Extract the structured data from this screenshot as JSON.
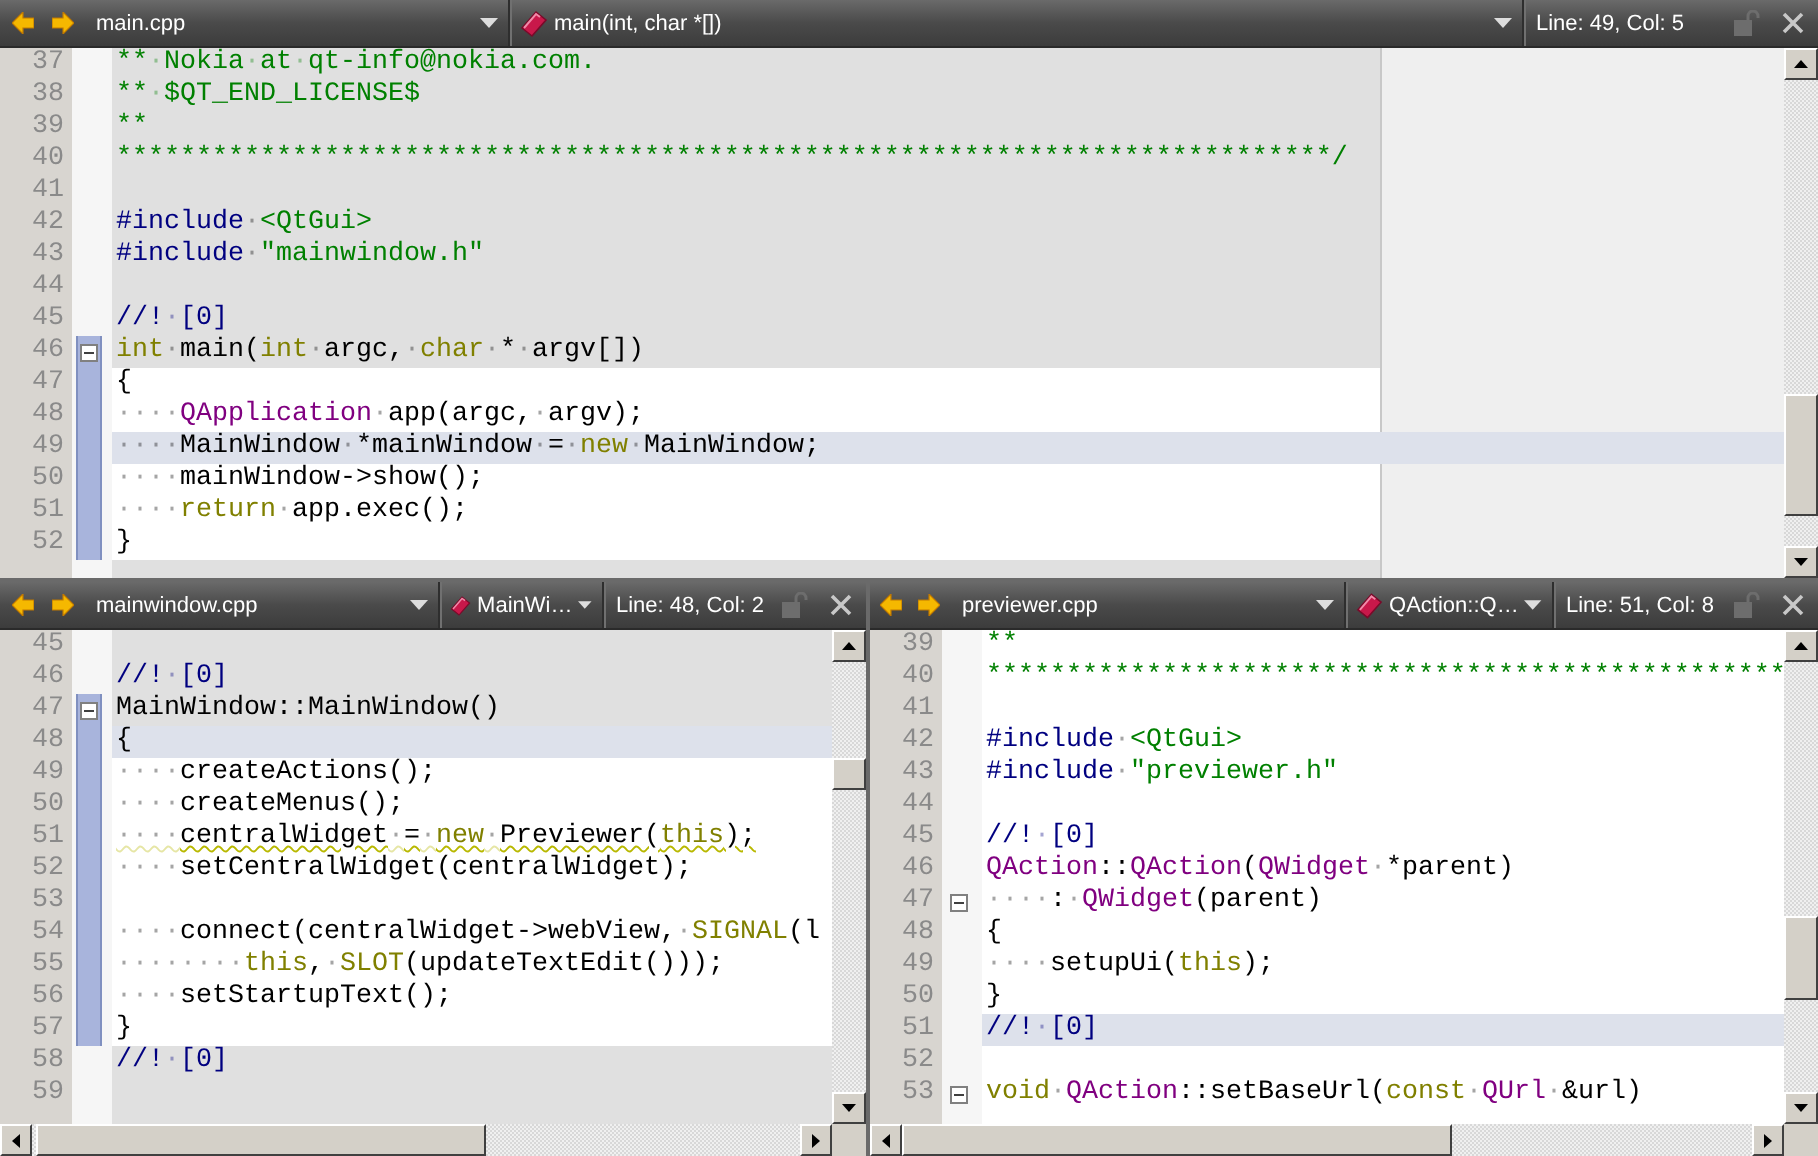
{
  "panes": [
    {
      "toolbar": {
        "file": "main.cpp",
        "symbol": "main(int, char *[])",
        "position": "Line: 49, Col: 5"
      },
      "dimmed": true,
      "lines": [
        {
          "number": "37",
          "tokens": [
            {
              "kind": "comment",
              "text": "**·Nokia·at·qt-info@nokia.com."
            }
          ]
        },
        {
          "number": "38",
          "tokens": [
            {
              "kind": "comment",
              "text": "**·$QT_END_LICENSE$"
            }
          ]
        },
        {
          "number": "39",
          "tokens": [
            {
              "kind": "comment",
              "text": "**"
            }
          ]
        },
        {
          "number": "40",
          "tokens": [
            {
              "kind": "comment",
              "text": "****************************************************************************/"
            }
          ]
        },
        {
          "number": "41"
        },
        {
          "number": "42",
          "tokens": [
            {
              "kind": "preproc",
              "text": "#include"
            },
            {
              "kind": "plain",
              "text": "·"
            },
            {
              "kind": "string",
              "text": "<QtGui>"
            }
          ]
        },
        {
          "number": "43",
          "tokens": [
            {
              "kind": "preproc",
              "text": "#include"
            },
            {
              "kind": "plain",
              "text": "·"
            },
            {
              "kind": "string",
              "text": "\"mainwindow.h\""
            }
          ]
        },
        {
          "number": "44"
        },
        {
          "number": "45",
          "tokens": [
            {
              "kind": "doc",
              "text": "//!·[0]"
            }
          ]
        },
        {
          "number": "46",
          "fold": true,
          "scope": true,
          "in_block": false,
          "current": false,
          "tokens": [
            {
              "kind": "keyword",
              "text": "int"
            },
            {
              "kind": "plain",
              "text": "·main("
            },
            {
              "kind": "keyword",
              "text": "int"
            },
            {
              "kind": "plain",
              "text": "·argc,·"
            },
            {
              "kind": "keyword",
              "text": "char"
            },
            {
              "kind": "plain",
              "text": "·*·argv[])"
            }
          ]
        },
        {
          "number": "47",
          "scope": true,
          "in_block": true,
          "current": false,
          "tokens": [
            {
              "kind": "plain",
              "text": "{"
            }
          ]
        },
        {
          "number": "48",
          "scope": true,
          "in_block": true,
          "current": false,
          "tokens": [
            {
              "kind": "plain",
              "text": "····"
            },
            {
              "kind": "type",
              "text": "QApplication"
            },
            {
              "kind": "plain",
              "text": "·app(argc,·argv);"
            }
          ]
        },
        {
          "number": "49",
          "scope": true,
          "current": true,
          "tokens": [
            {
              "kind": "plain",
              "text": "····MainWindow·*mainWindow·=·"
            },
            {
              "kind": "keyword",
              "text": "new"
            },
            {
              "kind": "plain",
              "text": "·MainWindow;"
            }
          ]
        },
        {
          "number": "50",
          "scope": true,
          "in_block": true,
          "current": false,
          "tokens": [
            {
              "kind": "plain",
              "text": "····mainWindow->show();"
            }
          ]
        },
        {
          "number": "51",
          "scope": true,
          "in_block": true,
          "current": false,
          "tokens": [
            {
              "kind": "plain",
              "text": "····"
            },
            {
              "kind": "keyword",
              "text": "return"
            },
            {
              "kind": "plain",
              "text": "·app.exec();"
            }
          ]
        },
        {
          "number": "52",
          "scope": true,
          "in_block": true,
          "current": false,
          "tokens": [
            {
              "kind": "plain",
              "text": "}"
            }
          ]
        }
      ]
    },
    {
      "toolbar": {
        "file": "mainwindow.cpp",
        "symbol": "MainWi…",
        "position": "Line: 48, Col: 2"
      },
      "dimmed": true,
      "lines": [
        {
          "number": "45"
        },
        {
          "number": "46",
          "tokens": [
            {
              "kind": "doc",
              "text": "//!·[0]"
            }
          ]
        },
        {
          "number": "47",
          "fold": true,
          "scope": true,
          "in_block": false,
          "current": false,
          "tokens": [
            {
              "kind": "plain",
              "text": "MainWindow::MainWindow()"
            }
          ]
        },
        {
          "number": "48",
          "scope": true,
          "current": true,
          "tokens": [
            {
              "kind": "plain",
              "text": "{"
            }
          ]
        },
        {
          "number": "49",
          "scope": true,
          "in_block": true,
          "current": false,
          "tokens": [
            {
              "kind": "plain",
              "text": "····createActions();"
            }
          ]
        },
        {
          "number": "50",
          "scope": true,
          "in_block": true,
          "current": false,
          "tokens": [
            {
              "kind": "plain",
              "text": "····createMenus();"
            }
          ]
        },
        {
          "number": "51",
          "scope": true,
          "in_block": true,
          "current": false,
          "warning": true,
          "tokens": [
            {
              "kind": "plain",
              "text": "····centralWidget·=·"
            },
            {
              "kind": "keyword",
              "text": "new"
            },
            {
              "kind": "plain",
              "text": "·Previewer("
            },
            {
              "kind": "keyword",
              "text": "this"
            },
            {
              "kind": "plain",
              "text": ");"
            }
          ]
        },
        {
          "number": "52",
          "scope": true,
          "in_block": true,
          "current": false,
          "tokens": [
            {
              "kind": "plain",
              "text": "····setCentralWidget(centralWidget);"
            }
          ]
        },
        {
          "number": "53",
          "scope": true,
          "in_block": true,
          "current": false
        },
        {
          "number": "54",
          "scope": true,
          "in_block": true,
          "current": false,
          "tokens": [
            {
              "kind": "plain",
              "text": "····connect(centralWidget->webView,·"
            },
            {
              "kind": "keyword",
              "text": "SIGNAL"
            },
            {
              "kind": "plain",
              "text": "(l"
            }
          ]
        },
        {
          "number": "55",
          "scope": true,
          "in_block": true,
          "current": false,
          "tokens": [
            {
              "kind": "plain",
              "text": "········"
            },
            {
              "kind": "keyword",
              "text": "this"
            },
            {
              "kind": "plain",
              "text": ",·"
            },
            {
              "kind": "keyword",
              "text": "SLOT"
            },
            {
              "kind": "plain",
              "text": "(updateTextEdit()));"
            }
          ]
        },
        {
          "number": "56",
          "scope": true,
          "in_block": true,
          "current": false,
          "tokens": [
            {
              "kind": "plain",
              "text": "····setStartupText();"
            }
          ]
        },
        {
          "number": "57",
          "scope": true,
          "in_block": true,
          "current": false,
          "tokens": [
            {
              "kind": "plain",
              "text": "}"
            }
          ]
        },
        {
          "number": "58",
          "tokens": [
            {
              "kind": "doc",
              "text": "//!·[0]"
            }
          ]
        },
        {
          "number": "59"
        }
      ]
    },
    {
      "toolbar": {
        "file": "previewer.cpp",
        "symbol": "QAction::Q…",
        "position": "Line: 51, Col: 8"
      },
      "dimmed": false,
      "lines": [
        {
          "number": "39",
          "tokens": [
            {
              "kind": "comment",
              "text": "**"
            }
          ]
        },
        {
          "number": "40",
          "tokens": [
            {
              "kind": "comment",
              "text": "**************************************************"
            }
          ]
        },
        {
          "number": "41"
        },
        {
          "number": "42",
          "tokens": [
            {
              "kind": "preproc",
              "text": "#include"
            },
            {
              "kind": "plain",
              "text": "·"
            },
            {
              "kind": "string",
              "text": "<QtGui>"
            }
          ]
        },
        {
          "number": "43",
          "tokens": [
            {
              "kind": "preproc",
              "text": "#include"
            },
            {
              "kind": "plain",
              "text": "·"
            },
            {
              "kind": "string",
              "text": "\"previewer.h\""
            }
          ]
        },
        {
          "number": "44"
        },
        {
          "number": "45",
          "tokens": [
            {
              "kind": "doc",
              "text": "//!·[0]"
            }
          ]
        },
        {
          "number": "46",
          "tokens": [
            {
              "kind": "type",
              "text": "QAction"
            },
            {
              "kind": "plain",
              "text": "::"
            },
            {
              "kind": "type",
              "text": "QAction"
            },
            {
              "kind": "plain",
              "text": "("
            },
            {
              "kind": "type",
              "text": "QWidget"
            },
            {
              "kind": "plain",
              "text": "·*parent)"
            }
          ]
        },
        {
          "number": "47",
          "fold": true,
          "tokens": [
            {
              "kind": "plain",
              "text": "····:·"
            },
            {
              "kind": "type",
              "text": "QWidget"
            },
            {
              "kind": "plain",
              "text": "(parent)"
            }
          ]
        },
        {
          "number": "48",
          "tokens": [
            {
              "kind": "plain",
              "text": "{"
            }
          ]
        },
        {
          "number": "49",
          "tokens": [
            {
              "kind": "plain",
              "text": "····setupUi("
            },
            {
              "kind": "keyword",
              "text": "this"
            },
            {
              "kind": "plain",
              "text": ");"
            }
          ]
        },
        {
          "number": "50",
          "tokens": [
            {
              "kind": "plain",
              "text": "}"
            }
          ]
        },
        {
          "number": "51",
          "current": true,
          "tokens": [
            {
              "kind": "doc",
              "text": "//!·[0]"
            }
          ]
        },
        {
          "number": "52"
        },
        {
          "number": "53",
          "fold": true,
          "tokens": [
            {
              "kind": "keyword",
              "text": "void"
            },
            {
              "kind": "plain",
              "text": "·"
            },
            {
              "kind": "type",
              "text": "QAction"
            },
            {
              "kind": "plain",
              "text": "::setBaseUrl("
            },
            {
              "kind": "keyword",
              "text": "const"
            },
            {
              "kind": "plain",
              "text": "·"
            },
            {
              "kind": "type",
              "text": "QUrl"
            },
            {
              "kind": "plain",
              "text": "·&url)"
            }
          ]
        }
      ]
    }
  ]
}
